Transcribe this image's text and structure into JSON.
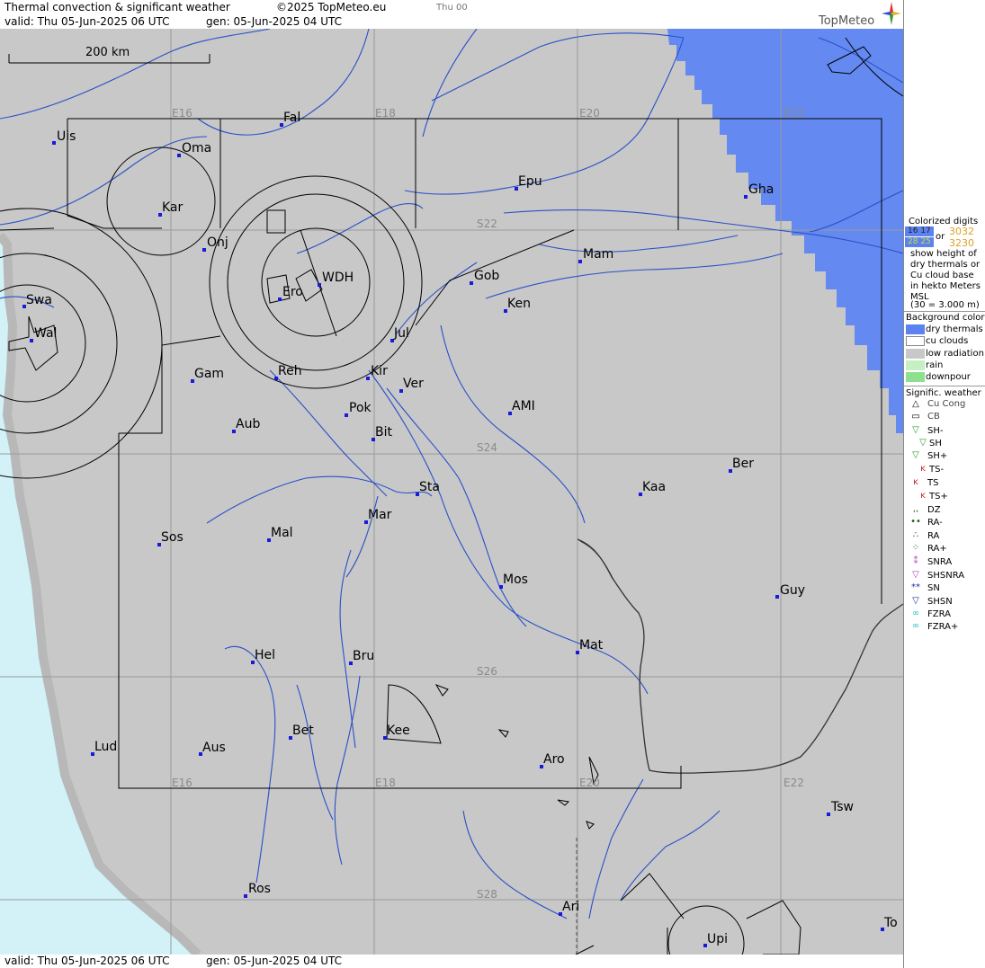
{
  "header": {
    "title": "Thermal convection & significant weather",
    "copyright": "©2025 TopMeteo.eu",
    "time_tab": "Thu 00",
    "valid": "valid:  Thu  05-Jun-2025  06 UTC",
    "gen": "gen: 05-Jun-2025 04 UTC",
    "logo": "TopMeteo"
  },
  "footer": {
    "valid": "valid:  Thu  05-Jun-2025  06 UTC",
    "gen": "gen: 05-Jun-2025 04 UTC"
  },
  "map": {
    "scale_label": "200 km",
    "grid_labels": [
      "E16",
      "E18",
      "E20",
      "E22",
      "S22",
      "S24",
      "S26",
      "S28",
      "E16",
      "E18",
      "E20",
      "E22"
    ],
    "places": [
      {
        "name": "Uis"
      },
      {
        "name": "Fal"
      },
      {
        "name": "Oma"
      },
      {
        "name": "Kar"
      },
      {
        "name": "Epu"
      },
      {
        "name": "Gha"
      },
      {
        "name": "Onj"
      },
      {
        "name": "Mam"
      },
      {
        "name": "Swa"
      },
      {
        "name": "Ero"
      },
      {
        "name": "WDH"
      },
      {
        "name": "Gob"
      },
      {
        "name": "Ken"
      },
      {
        "name": "Wal"
      },
      {
        "name": "Jul"
      },
      {
        "name": "Gam"
      },
      {
        "name": "Reh"
      },
      {
        "name": "Kir"
      },
      {
        "name": "Ver"
      },
      {
        "name": "Aub"
      },
      {
        "name": "Pok"
      },
      {
        "name": "AMI"
      },
      {
        "name": "Bit"
      },
      {
        "name": "Ber"
      },
      {
        "name": "Kaa"
      },
      {
        "name": "Sta"
      },
      {
        "name": "Mar"
      },
      {
        "name": "Sos"
      },
      {
        "name": "Mal"
      },
      {
        "name": "Mos"
      },
      {
        "name": "Guy"
      },
      {
        "name": "Mat"
      },
      {
        "name": "Hel"
      },
      {
        "name": "Bru"
      },
      {
        "name": "Bet"
      },
      {
        "name": "Kee"
      },
      {
        "name": "Lud"
      },
      {
        "name": "Aus"
      },
      {
        "name": "Aro"
      },
      {
        "name": "Tsw"
      },
      {
        "name": "Ros"
      },
      {
        "name": "Ari"
      },
      {
        "name": "To"
      },
      {
        "name": "Upi"
      }
    ]
  },
  "legend": {
    "colorized_title": [
      "Colorized digits"
    ],
    "digit_samples": {
      "dry_a": "16 17",
      "dry_b": "28 25",
      "cu_a": "3032",
      "cu_b": "3230",
      "or": "or"
    },
    "description": [
      "show height of",
      "dry thermals or",
      "Cu cloud base",
      "in hekto Meters",
      "MSL",
      "(30 = 3.000 m)"
    ],
    "background_title": "Background color",
    "background_items": [
      {
        "label": "dry thermals",
        "color": "#5b82f0"
      },
      {
        "label": "cu clouds",
        "color": "#ffffff"
      },
      {
        "label": "low radiation",
        "color": "#c8c8c8"
      },
      {
        "label": "rain",
        "color": "#c4f0c4"
      },
      {
        "label": "downpour",
        "color": "#8ee08e"
      }
    ],
    "weather_title": "Signific. weather",
    "weather_items": [
      {
        "label": "Cu Cong",
        "icon": "cu-cong-icon",
        "color": "#000000"
      },
      {
        "label": "CB",
        "icon": "cb-icon",
        "color": "#000000"
      },
      {
        "label": "SH-",
        "icon": "shower-light-icon",
        "color": "#2a9a2a"
      },
      {
        "label": "SH",
        "icon": "shower-icon",
        "color": "#2a9a2a"
      },
      {
        "label": "SH+",
        "icon": "shower-heavy-icon",
        "color": "#2a9a2a"
      },
      {
        "label": "TS-",
        "icon": "thunderstorm-light-icon",
        "color": "#c0282a"
      },
      {
        "label": "TS",
        "icon": "thunderstorm-icon",
        "color": "#c0282a"
      },
      {
        "label": "TS+",
        "icon": "thunderstorm-heavy-icon",
        "color": "#c0282a"
      },
      {
        "label": "DZ",
        "icon": "drizzle-icon",
        "color": "#1a5a1a"
      },
      {
        "label": "RA-",
        "icon": "rain-light-icon",
        "color": "#1a5a1a"
      },
      {
        "label": "RA",
        "icon": "rain-icon",
        "color": "#1a5a1a"
      },
      {
        "label": "RA+",
        "icon": "rain-heavy-icon",
        "color": "#1a5a1a"
      },
      {
        "label": "SNRA",
        "icon": "snow-rain-icon",
        "color": "#b040c0"
      },
      {
        "label": "SHSNRA",
        "icon": "snow-rain-shower-icon",
        "color": "#b040c0"
      },
      {
        "label": "SN",
        "icon": "snow-icon",
        "color": "#2030a0"
      },
      {
        "label": "SHSN",
        "icon": "snow-shower-icon",
        "color": "#2030a0"
      },
      {
        "label": "FZRA",
        "icon": "freezing-rain-icon",
        "color": "#30c0d0"
      },
      {
        "label": "FZRA+",
        "icon": "freezing-rain-heavy-icon",
        "color": "#30c0d0"
      }
    ]
  }
}
